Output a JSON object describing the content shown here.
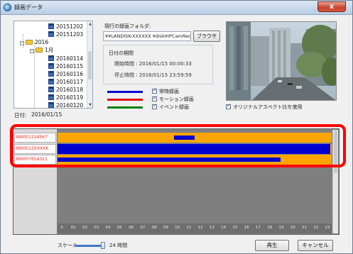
{
  "window": {
    "title": "録画データ",
    "close_glyph": "x"
  },
  "tree": {
    "items": [
      {
        "label": "20151202",
        "type": "day"
      },
      {
        "label": "20151203",
        "type": "day"
      },
      {
        "label": "2016",
        "type": "year"
      },
      {
        "label": "1月",
        "type": "month"
      },
      {
        "label": "20160114",
        "type": "day"
      },
      {
        "label": "20160115",
        "type": "day"
      },
      {
        "label": "20160116",
        "type": "day"
      },
      {
        "label": "20160117",
        "type": "day"
      },
      {
        "label": "20160118",
        "type": "day"
      },
      {
        "label": "20160119",
        "type": "day"
      },
      {
        "label": "20160120",
        "type": "day"
      }
    ]
  },
  "date": {
    "label": "日付:",
    "value": "2016/01/15"
  },
  "folder": {
    "label": "現行の録画フォルダ:",
    "path": "¥¥LANDISK-XXXXXX ¥disk¥IPCamReco",
    "browse_label": "ブラウザ"
  },
  "period": {
    "title": "日付の期間",
    "start": "開始時間 : 2016/01/15 00:00:33",
    "stop": "停止時間 : 2016/01/15 23:59:59"
  },
  "legend": [
    {
      "label": "常時録画",
      "color": "#0000d0"
    },
    {
      "label": "モーション録画",
      "color": "#e00000"
    },
    {
      "label": "イベント録画",
      "color": "#008000"
    }
  ],
  "preview": {
    "aspect_label": "オリジナルアスペクト比を使用"
  },
  "cameras": [
    {
      "name": "NW001234567",
      "segments": [
        {
          "start": 10.2,
          "end": 12.0,
          "style": "thin"
        }
      ]
    },
    {
      "name": "NW0012XXXXX",
      "segments": [
        {
          "start": 0.0,
          "end": 23.9,
          "style": "full"
        }
      ]
    },
    {
      "name": "NW007654321",
      "segments": [
        {
          "start": 0.0,
          "end": 19.5,
          "style": "thin"
        }
      ]
    }
  ],
  "hours": [
    "0",
    "01",
    "02",
    "03",
    "04",
    "05",
    "06",
    "07",
    "08",
    "09",
    "10",
    "11",
    "12",
    "13",
    "14",
    "15",
    "16",
    "17",
    "18",
    "19",
    "20",
    "21",
    "22",
    "23"
  ],
  "scale": {
    "label": "スケール",
    "value": "24 時間"
  },
  "buttons": {
    "play": "再生",
    "cancel": "キャンセル"
  }
}
